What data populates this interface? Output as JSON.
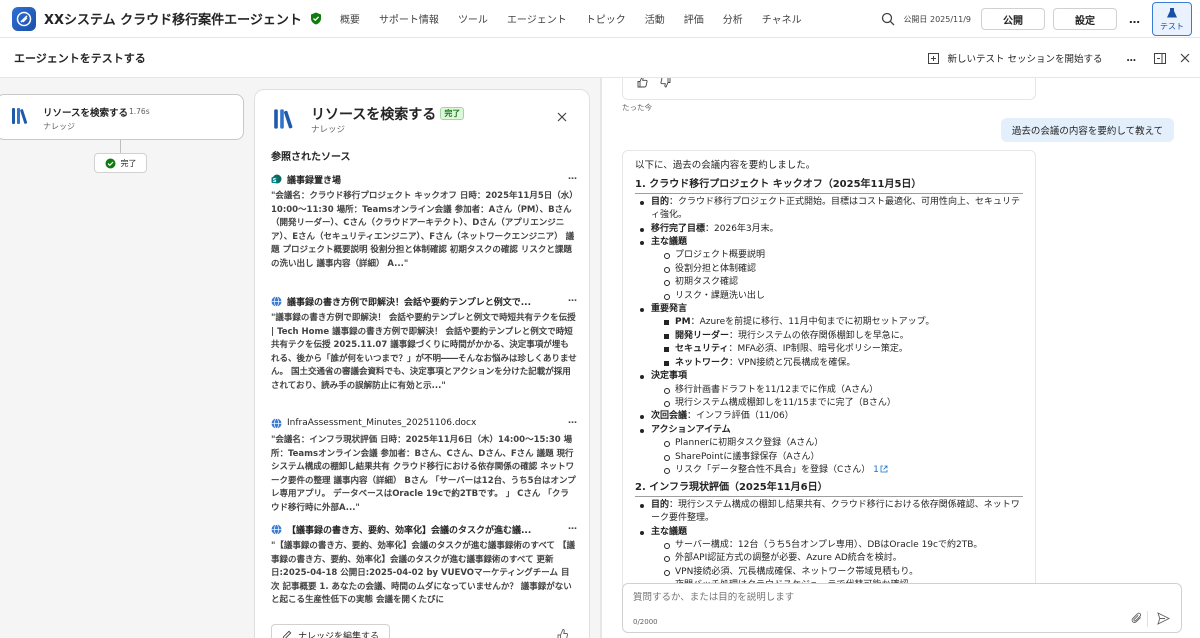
{
  "header": {
    "app_title": "XXシステム クラウド移行案件エージェント",
    "nav": [
      "概要",
      "サポート情報",
      "ツール",
      "エージェント",
      "トピック",
      "活動",
      "評価",
      "分析",
      "チャネル"
    ],
    "published_date": "公開日 2025/11/9",
    "publish_label": "公開",
    "settings_label": "設定",
    "more_label": "…",
    "test_label": "テスト"
  },
  "subheader": {
    "title": "エージェントをテストする",
    "new_session_label": "新しいテスト セッションを開始する",
    "more_label": "…"
  },
  "canvas": {
    "node_title": "リソースを検索する",
    "node_duration": "1.76s",
    "node_subtitle": "ナレッジ",
    "done_label": "完了"
  },
  "panel": {
    "title": "リソースを検索する",
    "badge": "完了",
    "subtitle": "ナレッジ",
    "section_title": "参照されたソース",
    "sources": [
      {
        "title": "議事録置き場",
        "icon": "sharepoint-icon",
        "more": "…",
        "body": "\"会議名：クラウド移行プロジェクト キックオフ 日時：2025年11月5日（水）10:00〜11:30 場所：Teamsオンライン会議 参加者：Aさん（PM）、Bさん（開発リーダー）、Cさん（クラウドアーキテクト）、Dさん（アプリエンジニア）、Eさん（セキュリティエンジニア）、Fさん（ネットワークエンジニア） 議題 プロジェクト概要説明 役割分担と体制確認 初期タスクの確認 リスクと課題の洗い出し 議事内容（詳細） A...\""
      },
      {
        "title": "議事録の書き方例で即解決！会話や要約テンプレと例文で...",
        "icon": "globe-icon",
        "more": "…",
        "body": "\"議事録の書き方例で即解決！ 会話や要約テンプレと例文で時短共有テクを伝授 | Tech Home 議事録の書き方例で即解決！ 会話や要約テンプレと例文で時短共有テクを伝授 2025.11.07 議事録づくりに時間がかかる、決定事項が埋もれる、後から「誰が何をいつまで？」が不明――そんなお悩みは珍しくありません。 国土交通省の審議会資料でも、決定事項とアクションを分けた記載が採用されており、読み手の誤解防止に有効と示...\""
      },
      {
        "title": "InfraAssessment_Minutes_20251106.docx",
        "icon": "globe-icon",
        "more": "…",
        "body": "\"会議名：インフラ現状評価 日時：2025年11月6日（木）14:00〜15:30 場所：Teamsオンライン会議 参加者：Bさん、Cさん、Dさん、Fさん 議題 現行システム構成の棚卸し結果共有 クラウド移行における依存関係の確認 ネットワーク要件の整理 議事内容（詳細） Bさん 「サーバーは12台、うち5台はオンプレ専用アプリ。 データベースはOracle 19cで約2TBです。 」 Cさん 「クラウド移行時に外部A...\""
      },
      {
        "title": "【議事録の書き方、要約、効率化】会議のタスクが進む議...",
        "icon": "globe-icon",
        "more": "…",
        "body": "\"【議事録の書き方、要約、効率化】会議のタスクが進む議事録術のすべて 【議事録の書き方、要約、効率化】会議のタスクが進む議事録術のすべて 更新日:2025-04-18 公開日:2025-04-02 by VUEVOマーケティングチーム 目次 記事概要 1. あなたの会議、時間のムダになっていませんか？ 議事録がないと起こる生産性低下の実態 会議を開くたびに"
      }
    ],
    "edit_label": "ナレッジを編集する"
  },
  "chat": {
    "time_ago": "たった今",
    "user_message": "過去の会議の内容を要約して教えて",
    "intro": "以下に、過去の会議内容を要約しました。",
    "s1_title": "1. クラウド移行プロジェクト キックオフ（2025年11月5日）",
    "s1_purpose_k": "目的",
    "s1_purpose_v": "：クラウド移行プロジェクト正式開始。目標はコスト最適化、可用性向上、セキュリティ強化。",
    "s1_target_k": "移行完了目標",
    "s1_target_v": "：2026年3月末。",
    "s1_agenda_k": "主な議題",
    "s1_agenda": [
      "プロジェクト概要説明",
      "役割分担と体制確認",
      "初期タスク確認",
      "リスク・課題洗い出し"
    ],
    "s1_remarks_k": "重要発言",
    "s1_pm_k": "PM",
    "s1_pm_v": "：Azureを前提に移行、11月中旬までに初期セットアップ。",
    "s1_dev_k": "開発リーダー",
    "s1_dev_v": "：現行システムの依存関係棚卸しを早急に。",
    "s1_sec_k": "セキュリティ",
    "s1_sec_v": "：MFA必須、IP制限、暗号化ポリシー策定。",
    "s1_net_k": "ネットワーク",
    "s1_net_v": "：VPN接続と冗長構成を確保。",
    "s1_decisions_k": "決定事項",
    "s1_decisions": [
      "移行計画書ドラフトを11/12までに作成（Aさん）",
      "現行システム構成棚卸しを11/15までに完了（Bさん）"
    ],
    "s1_next_k": "次回会議",
    "s1_next_v": "：インフラ評価（11/06）",
    "s1_actions_k": "アクションアイテム",
    "s1_actions": [
      "Plannerに初期タスク登録（Aさん）",
      "SharePointに議事録保存（Aさん）",
      "リスク「データ整合性不具合」を登録（Cさん）"
    ],
    "s1_ref": "1",
    "s2_title": "2. インフラ現状評価（2025年11月6日）",
    "s2_purpose_k": "目的",
    "s2_purpose_v": "：現行システム構成の棚卸し結果共有、クラウド移行における依存関係確認、ネットワーク要件整理。",
    "s2_agenda_k": "主な議題",
    "s2_agenda": [
      "サーバー構成：12台（うち5台オンプレ専用）、DBはOracle 19cで約2TB。",
      "外部API認証方式の調整が必要、Azure AD統合を検討。",
      "VPN接続必須、冗長構成確保、ネットワーク帯域見積もり。",
      "夜間バッチ処理はクラウドスケジューラで代替可能か確認。"
    ],
    "input_placeholder": "質問するか、または目的を説明します",
    "char_count": "0/2000"
  },
  "colors": {
    "accent": "#1a73c9",
    "done_green": "#107c10",
    "user_bubble": "#e3effb"
  }
}
